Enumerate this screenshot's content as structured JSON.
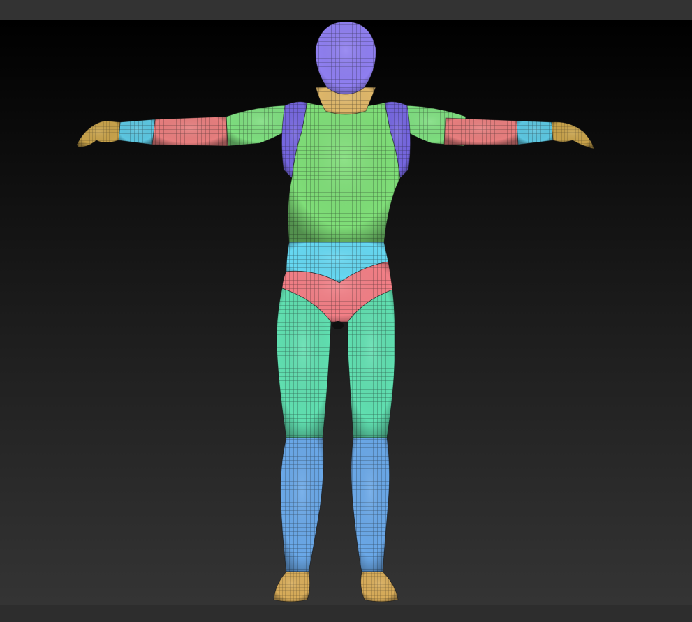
{
  "app": {
    "viewport_name": "3D viewport"
  },
  "colors": {
    "background_top": "#000000",
    "background_bottom": "#343434",
    "toolbar": "#333333",
    "statusbar": "#2d2d2d",
    "polygroup_head": "#8f7ff0",
    "polygroup_neck": "#e0b86a",
    "polygroup_torso": "#7fde78",
    "polygroup_shoulder": "#7566e0",
    "polygroup_upper_arm": "#7ede7f",
    "polygroup_forearm": "#e77e7e",
    "polygroup_wrist": "#5cc6e0",
    "polygroup_hand": "#c8a24a",
    "polygroup_belly": "#66d8f2",
    "polygroup_pelvis": "#f27f86",
    "polygroup_thigh": "#60dfb0",
    "polygroup_shin": "#6aa8e8",
    "polygroup_foot": "#d9ad5a"
  },
  "icons": {
    "model": "humanoid-mesh-icon"
  }
}
